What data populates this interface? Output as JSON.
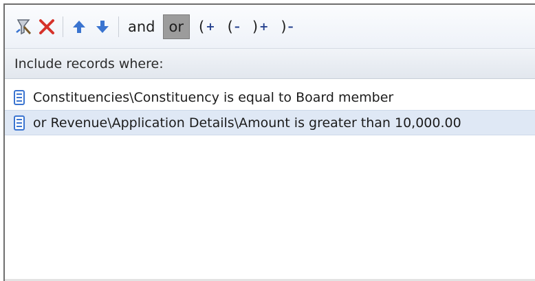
{
  "toolbar": {
    "buttons": [
      {
        "icon": "filter-wizard-icon"
      },
      {
        "icon": "delete-icon"
      },
      {
        "icon": "move-up-icon"
      },
      {
        "icon": "move-down-icon"
      }
    ],
    "and_label": "and",
    "or_label": "or",
    "or_pressed": true,
    "parens": {
      "add_open_label": "(",
      "remove_open_label": "(",
      "add_close_label": ")",
      "remove_close_label": ")",
      "plus_sign": "+",
      "minus_sign": "–"
    }
  },
  "header": {
    "label": "Include records where:"
  },
  "criteria": [
    {
      "text": "Constituencies\\Constituency is equal to Board member",
      "selected": false,
      "icon": "field-icon"
    },
    {
      "text": "or Revenue\\Application Details\\Amount is greater than 10,000.00",
      "selected": true,
      "icon": "field-icon"
    }
  ],
  "colors": {
    "accent_blue": "#3a74d0",
    "delete_red": "#d6322a",
    "selection": "#dfe8f5",
    "pressed": "#9c9c9c"
  }
}
